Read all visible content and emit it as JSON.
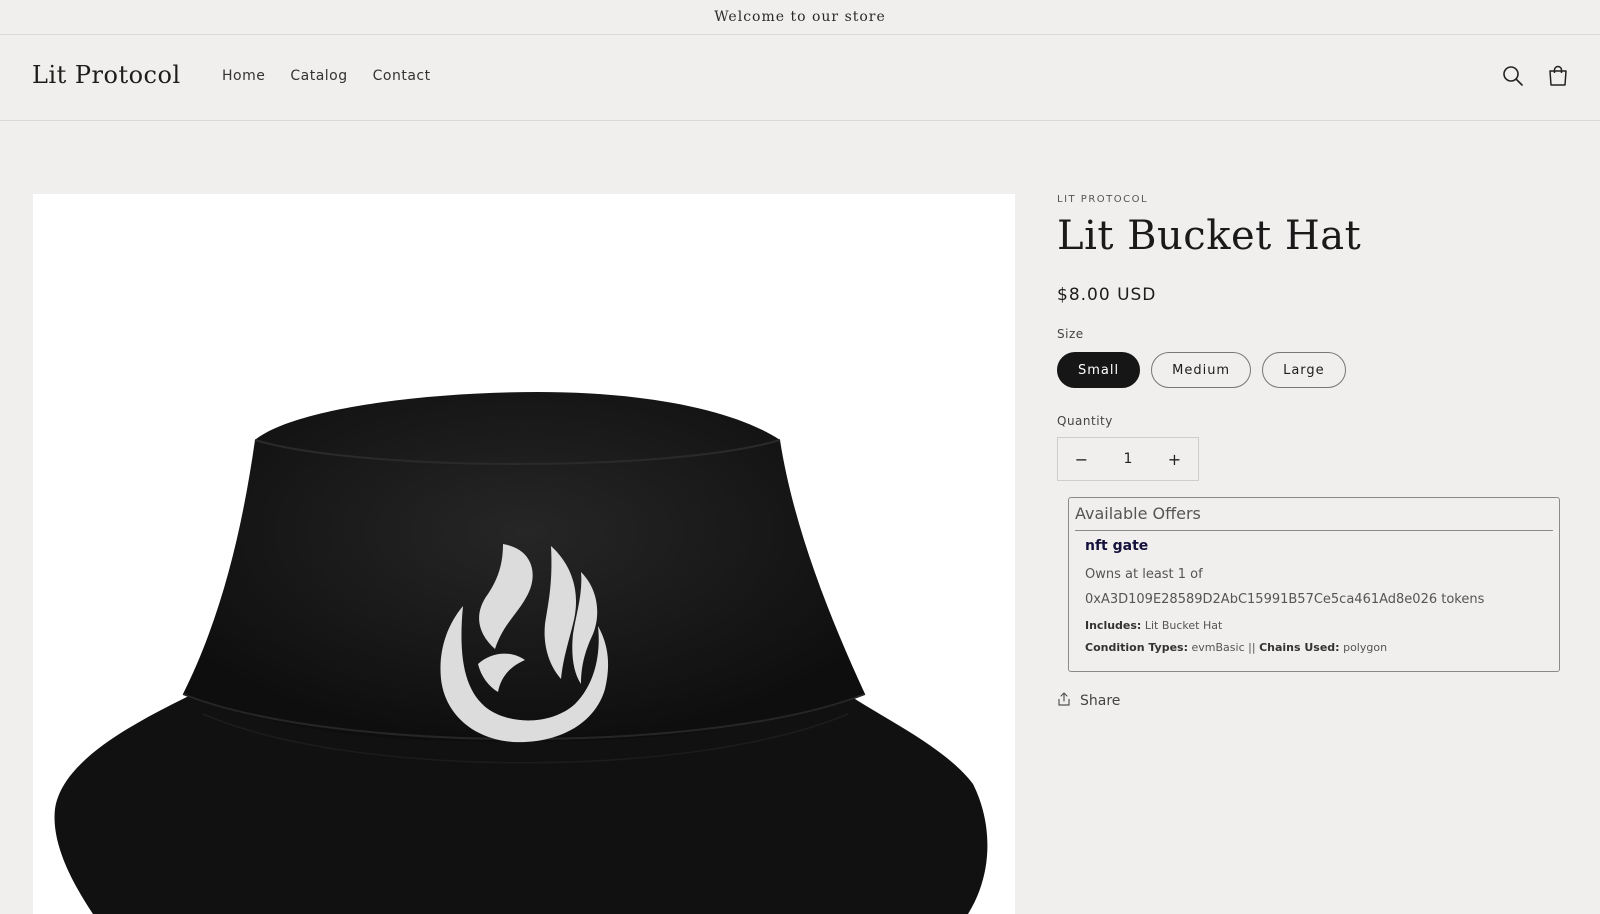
{
  "announcement": "Welcome to our store",
  "header": {
    "logo": "Lit Protocol",
    "nav": [
      "Home",
      "Catalog",
      "Contact"
    ]
  },
  "product": {
    "vendor": "LIT PROTOCOL",
    "title": "Lit Bucket Hat",
    "price": "$8.00 USD",
    "size_label": "Size",
    "sizes": [
      "Small",
      "Medium",
      "Large"
    ],
    "selected_size": "Small",
    "quantity_label": "Quantity",
    "quantity": "1",
    "decrease_glyph": "−",
    "increase_glyph": "+",
    "share_label": "Share"
  },
  "offers": {
    "title": "Available Offers",
    "name": "nft gate",
    "description": "Owns at least 1 of 0xA3D109E28589D2AbC15991B57Ce5ca461Ad8e026 tokens",
    "includes_label": "Includes:",
    "includes_value": "Lit Bucket Hat",
    "condition_label": "Condition Types:",
    "condition_value": "evmBasic",
    "separator": "||",
    "chains_label": "Chains Used:",
    "chains_value": "polygon"
  },
  "colors": {
    "background": "#f1efee",
    "selected_pill": "#161616",
    "offer_name": "#14123a"
  },
  "icons": [
    "search-icon",
    "cart-icon",
    "share-icon",
    "flame-logo"
  ]
}
